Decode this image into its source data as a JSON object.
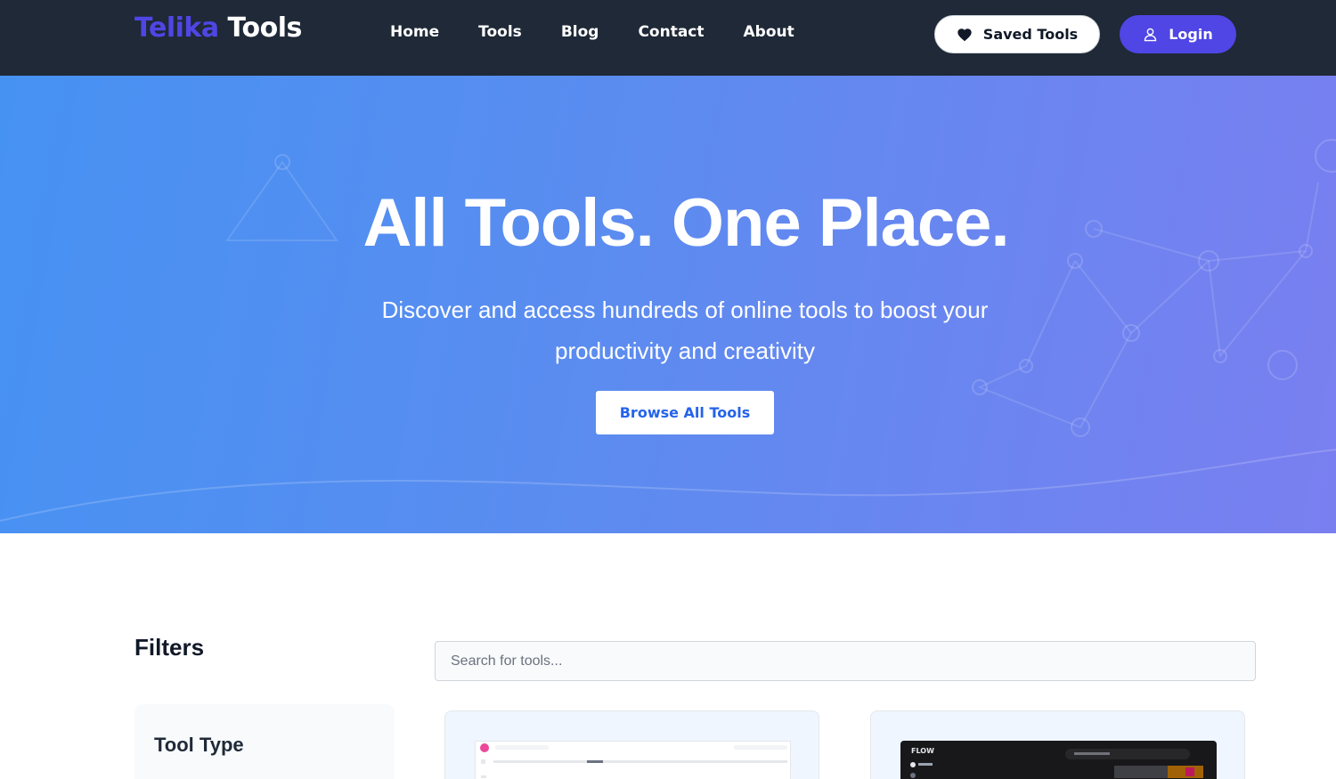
{
  "navbar": {
    "logo_part1": "Telika",
    "logo_part2": "Tools",
    "links": [
      "Home",
      "Tools",
      "Blog",
      "Contact",
      "About"
    ],
    "saved_label": "Saved Tools",
    "login_label": "Login"
  },
  "hero": {
    "title": "All Tools. One Place.",
    "subtitle": "Discover and access hundreds of online tools to boost your productivity and creativity",
    "cta": "Browse All Tools"
  },
  "filters": {
    "title": "Filters",
    "tool_type_label": "Tool Type"
  },
  "search": {
    "placeholder": "Search for tools..."
  },
  "cards": [
    {
      "thumbnail": "ui-screenshot-light",
      "brand": ""
    },
    {
      "thumbnail": "ui-screenshot-dark",
      "brand": "FLOW"
    }
  ],
  "colors": {
    "accent": "#4f46e5",
    "nav_bg": "#1f2937",
    "hero_start": "#4692f3",
    "hero_end": "#7a7ff0",
    "cta_text": "#2563eb"
  }
}
